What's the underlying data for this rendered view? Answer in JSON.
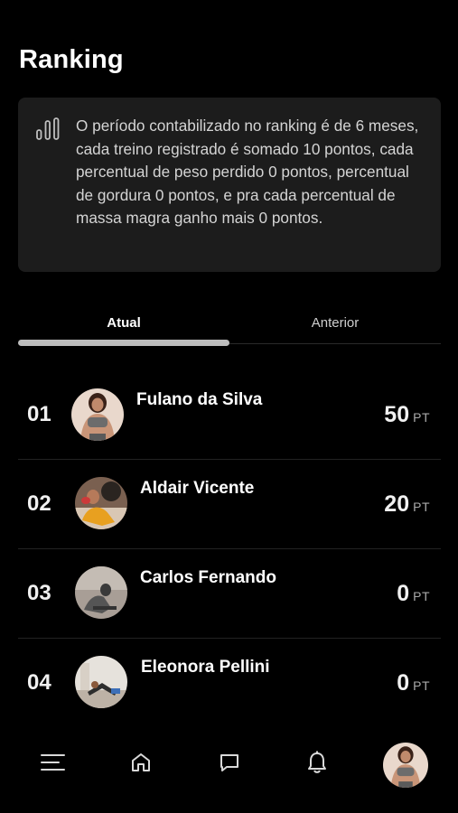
{
  "header": {
    "title": "Ranking"
  },
  "info": {
    "icon": "bar-chart-icon",
    "text": "O período contabilizado no ranking é de 6 meses, cada treino registrado é somado 10 pontos, cada percentual de peso perdido 0 pontos, percentual de gordura 0 pontos, e pra cada percentual de massa magra ganho mais 0 pontos."
  },
  "tabs": [
    {
      "label": "Atual",
      "active": true
    },
    {
      "label": "Anterior",
      "active": false
    }
  ],
  "ranking": [
    {
      "position": "01",
      "name": "Fulano da Silva",
      "score": "50",
      "unit": "PT"
    },
    {
      "position": "02",
      "name": "Aldair Vicente",
      "score": "20",
      "unit": "PT"
    },
    {
      "position": "03",
      "name": "Carlos Fernando",
      "score": "0",
      "unit": "PT"
    },
    {
      "position": "04",
      "name": "Eleonora Pellini",
      "score": "0",
      "unit": "PT"
    }
  ],
  "bottom_nav": {
    "items": [
      "menu-icon",
      "home-icon",
      "chat-icon",
      "bell-icon",
      "profile-avatar"
    ]
  },
  "colors": {
    "background": "#000000",
    "card": "#1c1c1c",
    "accent": "#bdbdbd"
  }
}
